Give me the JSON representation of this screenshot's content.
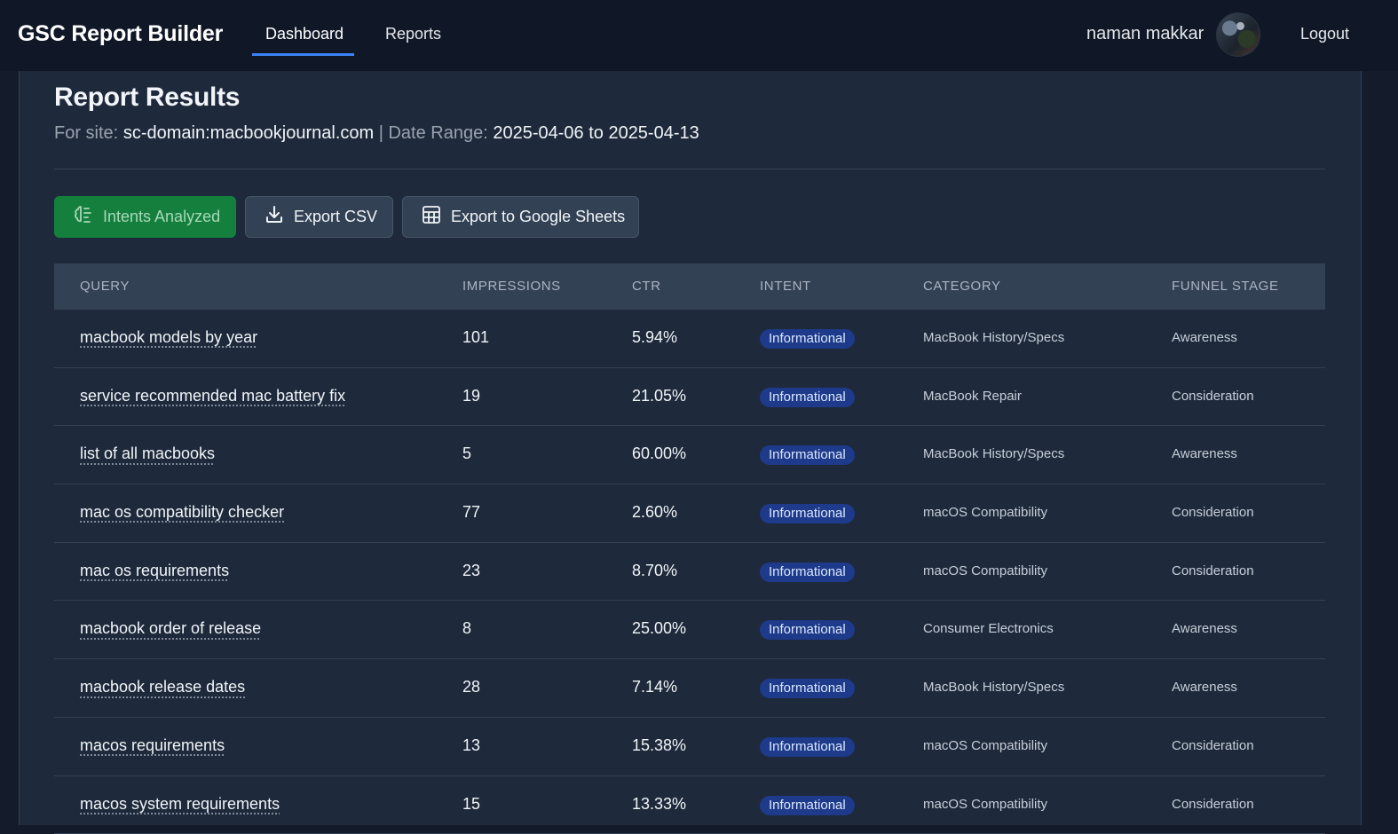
{
  "app": {
    "brand": "GSC Report Builder",
    "nav": [
      {
        "label": "Dashboard",
        "active": true
      },
      {
        "label": "Reports",
        "active": false
      }
    ],
    "user_name": "naman makkar",
    "logout_label": "Logout"
  },
  "report": {
    "title": "Report Results",
    "site_label": "For site:",
    "site_value": "sc-domain:macbookjournal.com",
    "separator": "|",
    "date_label": "Date Range:",
    "date_value": "2025-04-06 to 2025-04-13"
  },
  "actions": {
    "intents_label": "Intents Analyzed",
    "csv_label": "Export CSV",
    "sheets_label": "Export to Google Sheets"
  },
  "colors": {
    "accent": "#3b82f6",
    "success": "#15803d",
    "badge": "#1e3a8a"
  },
  "table": {
    "headers": [
      "QUERY",
      "IMPRESSIONS",
      "CTR",
      "INTENT",
      "CATEGORY",
      "FUNNEL STAGE"
    ],
    "rows": [
      {
        "query": "macbook models by year",
        "impressions": "101",
        "ctr": "5.94%",
        "intent": "Informational",
        "category": "MacBook History/Specs",
        "funnel": "Awareness"
      },
      {
        "query": "service recommended mac battery fix",
        "impressions": "19",
        "ctr": "21.05%",
        "intent": "Informational",
        "category": "MacBook Repair",
        "funnel": "Consideration"
      },
      {
        "query": "list of all macbooks",
        "impressions": "5",
        "ctr": "60.00%",
        "intent": "Informational",
        "category": "MacBook History/Specs",
        "funnel": "Awareness"
      },
      {
        "query": "mac os compatibility checker",
        "impressions": "77",
        "ctr": "2.60%",
        "intent": "Informational",
        "category": "macOS Compatibility",
        "funnel": "Consideration"
      },
      {
        "query": "mac os requirements",
        "impressions": "23",
        "ctr": "8.70%",
        "intent": "Informational",
        "category": "macOS Compatibility",
        "funnel": "Consideration"
      },
      {
        "query": "macbook order of release",
        "impressions": "8",
        "ctr": "25.00%",
        "intent": "Informational",
        "category": "Consumer Electronics",
        "funnel": "Awareness"
      },
      {
        "query": "macbook release dates",
        "impressions": "28",
        "ctr": "7.14%",
        "intent": "Informational",
        "category": "MacBook History/Specs",
        "funnel": "Awareness"
      },
      {
        "query": "macos requirements",
        "impressions": "13",
        "ctr": "15.38%",
        "intent": "Informational",
        "category": "macOS Compatibility",
        "funnel": "Consideration"
      },
      {
        "query": "macos system requirements",
        "impressions": "15",
        "ctr": "13.33%",
        "intent": "Informational",
        "category": "macOS Compatibility",
        "funnel": "Consideration"
      }
    ]
  }
}
